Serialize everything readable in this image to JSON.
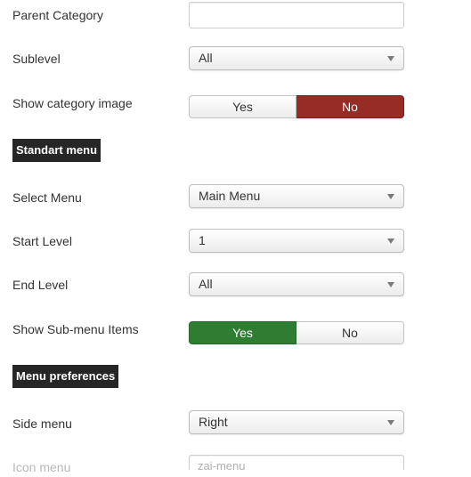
{
  "fields": {
    "parent_category": {
      "label": "Parent Category",
      "value": ""
    },
    "sublevel": {
      "label": "Sublevel",
      "value": "All"
    },
    "show_category_image": {
      "label": "Show category image",
      "yes": "Yes",
      "no": "No",
      "selected": "No"
    },
    "select_menu": {
      "label": "Select Menu",
      "value": "Main Menu"
    },
    "start_level": {
      "label": "Start Level",
      "value": "1"
    },
    "end_level": {
      "label": "End Level",
      "value": "All"
    },
    "show_submenu_items": {
      "label": "Show Sub-menu Items",
      "yes": "Yes",
      "no": "No",
      "selected": "Yes"
    },
    "side_menu": {
      "label": "Side menu",
      "value": "Right"
    },
    "icon_menu": {
      "label": "Icon menu",
      "value": "zai-menu"
    }
  },
  "sections": {
    "standart_menu": "Standart menu",
    "menu_preferences": "Menu preferences"
  },
  "colors": {
    "no_active": "#972b25",
    "yes_active": "#2f7d32",
    "section_header_bg": "#262626"
  },
  "icons": {
    "select_caret": "triangle-down"
  }
}
